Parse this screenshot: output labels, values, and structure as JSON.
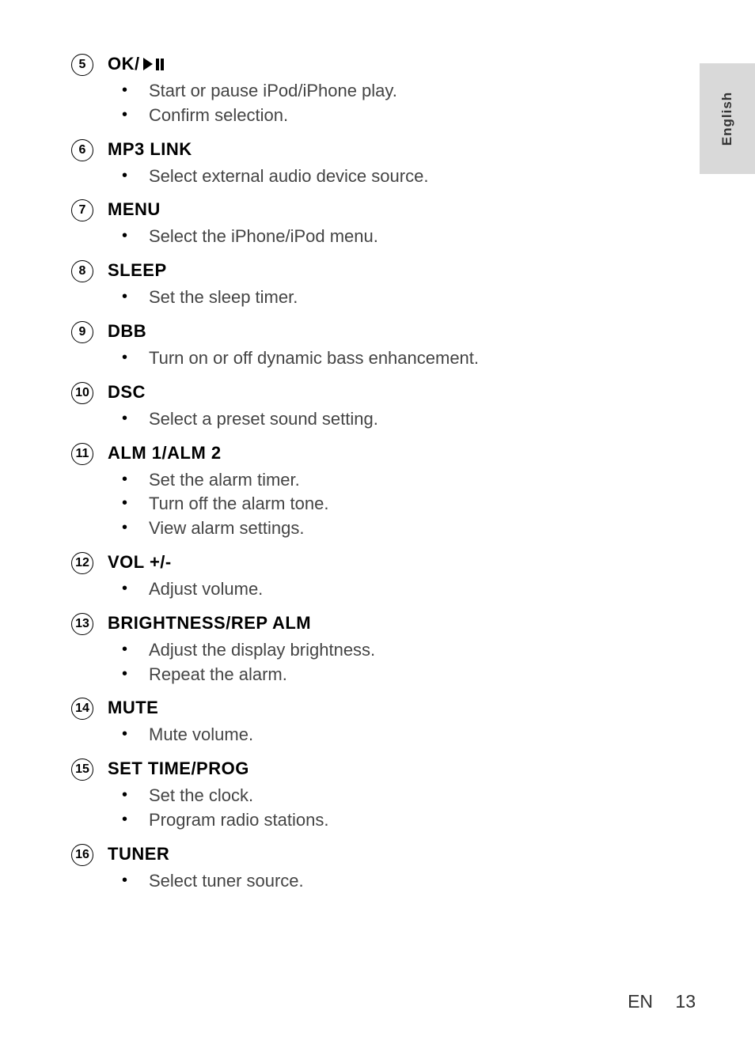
{
  "language_tab": "English",
  "items": [
    {
      "number": "5",
      "title": "OK/",
      "has_playpause_icon": true,
      "descriptions": [
        "Start or pause iPod/iPhone play.",
        "Confirm selection."
      ]
    },
    {
      "number": "6",
      "title": "MP3 LINK",
      "descriptions": [
        "Select external audio device source."
      ]
    },
    {
      "number": "7",
      "title": "MENU",
      "descriptions": [
        "Select the iPhone/iPod menu."
      ]
    },
    {
      "number": "8",
      "title": "SLEEP",
      "descriptions": [
        "Set the sleep timer."
      ]
    },
    {
      "number": "9",
      "title": "DBB",
      "descriptions": [
        "Turn on or off dynamic bass enhancement."
      ]
    },
    {
      "number": "10",
      "title": "DSC",
      "descriptions": [
        "Select a preset sound setting."
      ]
    },
    {
      "number": "11",
      "title": "ALM 1/ALM 2",
      "descriptions": [
        "Set the alarm timer.",
        "Turn off the alarm tone.",
        "View alarm settings."
      ]
    },
    {
      "number": "12",
      "title": "VOL +/-",
      "descriptions": [
        "Adjust volume."
      ]
    },
    {
      "number": "13",
      "title": "BRIGHTNESS/REP ALM",
      "descriptions": [
        "Adjust the display brightness.",
        "Repeat the alarm."
      ]
    },
    {
      "number": "14",
      "title": "MUTE",
      "descriptions": [
        "Mute volume."
      ]
    },
    {
      "number": "15",
      "title": "SET TIME/PROG",
      "descriptions": [
        "Set the clock.",
        "Program radio stations."
      ]
    },
    {
      "number": "16",
      "title": "TUNER",
      "descriptions": [
        "Select tuner source."
      ]
    }
  ],
  "footer": {
    "lang": "EN",
    "page": "13"
  }
}
